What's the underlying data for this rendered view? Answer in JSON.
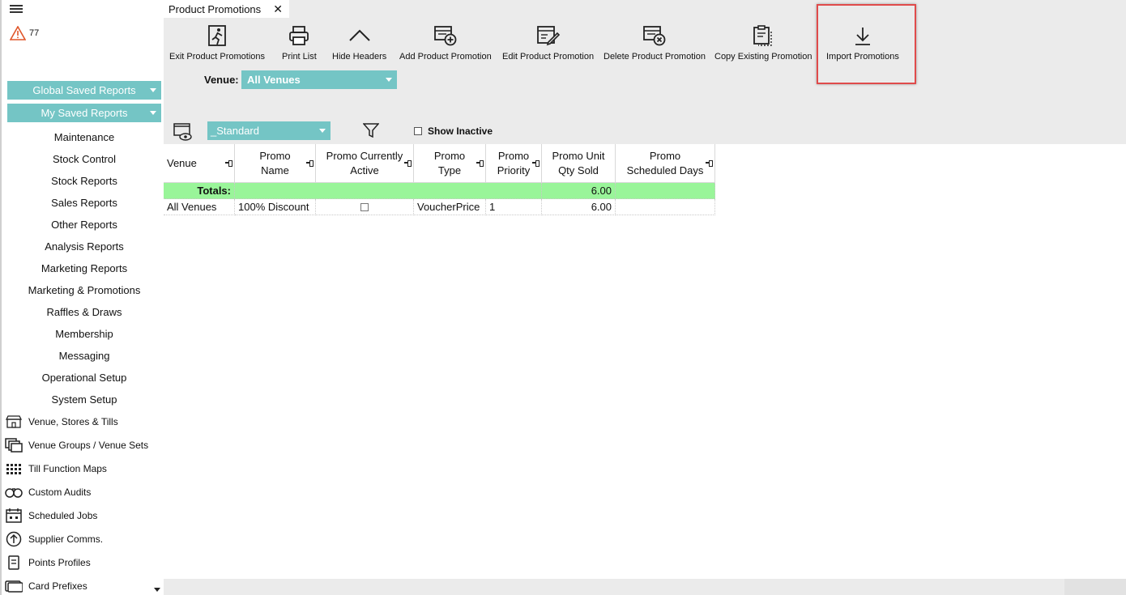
{
  "sidebar": {
    "alert_count": "77",
    "global_saved_reports": "Global Saved Reports",
    "my_saved_reports": "My Saved Reports",
    "menu_items": [
      "Maintenance",
      "Stock Control",
      "Stock Reports",
      "Sales Reports",
      "Other Reports",
      "Analysis Reports",
      "Marketing Reports",
      "Marketing & Promotions",
      "Raffles & Draws",
      "Membership",
      "Messaging",
      "Operational Setup",
      "System Setup"
    ],
    "icon_items": [
      "Venue, Stores & Tills",
      "Venue Groups / Venue Sets",
      "Till Function Maps",
      "Custom Audits",
      "Scheduled Jobs",
      "Supplier Comms.",
      "Points Profiles",
      "Card Prefixes"
    ]
  },
  "tab": {
    "title": "Product Promotions",
    "close": "✕"
  },
  "toolbar": {
    "exit": "Exit Product Promotions",
    "print": "Print List",
    "hide_headers": "Hide Headers",
    "add": "Add Product Promotion",
    "edit": "Edit Product Promotion",
    "delete": "Delete Product Promotion",
    "copy": "Copy Existing Promotion",
    "import": "Import Promotions"
  },
  "filters": {
    "venue_label": "Venue:",
    "venue_value": "All Venues",
    "layout_value": "_Standard",
    "show_inactive": "Show Inactive"
  },
  "grid": {
    "headers": {
      "venue": "Venue",
      "promo_name": "Promo Name",
      "promo_active": "Promo Currently Active",
      "promo_type": "Promo Type",
      "promo_priority": "Promo Priority",
      "qty_sold": "Promo Unit Qty Sold",
      "scheduled_days": "Promo Scheduled Days"
    },
    "totals": {
      "label": "Totals:",
      "qty_sold": "6.00"
    },
    "rows": [
      {
        "venue": "All Venues",
        "promo_name": "100% Discount",
        "promo_type": "VoucherPrice",
        "promo_priority": "1",
        "qty_sold": "6.00",
        "scheduled_days": ""
      }
    ]
  }
}
